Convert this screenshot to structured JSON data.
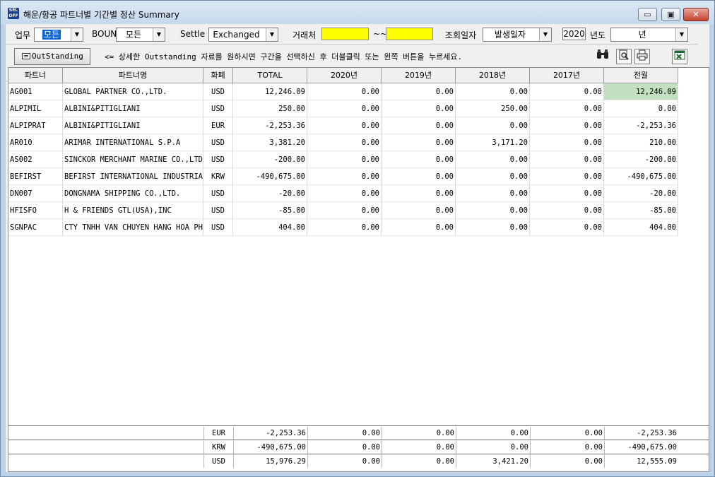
{
  "window": {
    "title": "해운/항공 파트너별 기간별 정산 Summary",
    "icon_text": "SEL OFF",
    "min_glyph": "▭",
    "max_glyph": "▣",
    "close_glyph": "✕"
  },
  "filters": {
    "business_label": "업무",
    "business_value": "모든",
    "bound_label": "BOUND",
    "bound_value": "모든",
    "settle_label": "Settle",
    "settle_value": "Exchanged",
    "partner_label": "거래처",
    "range_sep": "~~",
    "date_type_label": "조회일자",
    "date_type_value": "발생일자",
    "year_value": "2020",
    "year_label": "년도",
    "period_value": "년",
    "arrow": "▼"
  },
  "toolbar": {
    "outstanding_label": "OutStanding",
    "hint": "<= 상세한 Outstanding 자료를 원하시면 구간을 선택하신 후 더블클릭 또는 왼쪽 버튼을 누르세요.",
    "icons": [
      "binoculars-icon",
      "preview-icon",
      "print-icon",
      "excel-icon"
    ]
  },
  "columns": [
    "파트너",
    "파트너명",
    "화폐",
    "TOTAL",
    "2020년",
    "2019년",
    "2018년",
    "2017년",
    "전월"
  ],
  "rows": [
    {
      "code": "AG001",
      "name": "GLOBAL PARTNER CO.,LTD.",
      "cur": "USD",
      "total": "12,246.09",
      "y2020": "0.00",
      "y2019": "0.00",
      "y2018": "0.00",
      "y2017": "0.00",
      "prev": "12,246.09"
    },
    {
      "code": "ALPIMIL",
      "name": "ALBINI&PITIGLIANI",
      "cur": "USD",
      "total": "250.00",
      "y2020": "0.00",
      "y2019": "0.00",
      "y2018": "250.00",
      "y2017": "0.00",
      "prev": "0.00"
    },
    {
      "code": "ALPIPRAT",
      "name": "ALBINI&PITIGLIANI",
      "cur": "EUR",
      "total": "-2,253.36",
      "y2020": "0.00",
      "y2019": "0.00",
      "y2018": "0.00",
      "y2017": "0.00",
      "prev": "-2,253.36"
    },
    {
      "code": "AR010",
      "name": "ARIMAR INTERNATIONAL S.P.A",
      "cur": "USD",
      "total": "3,381.20",
      "y2020": "0.00",
      "y2019": "0.00",
      "y2018": "3,171.20",
      "y2017": "0.00",
      "prev": "210.00"
    },
    {
      "code": "AS002",
      "name": "SINCKOR MERCHANT MARINE CO.,LTD",
      "cur": "USD",
      "total": "-200.00",
      "y2020": "0.00",
      "y2019": "0.00",
      "y2018": "0.00",
      "y2017": "0.00",
      "prev": "-200.00"
    },
    {
      "code": "BEFIRST",
      "name": "BEFIRST INTERNATIONAL INDUSTRIAL",
      "cur": "KRW",
      "total": "-490,675.00",
      "y2020": "0.00",
      "y2019": "0.00",
      "y2018": "0.00",
      "y2017": "0.00",
      "prev": "-490,675.00"
    },
    {
      "code": "DN007",
      "name": "DONGNAMA SHIPPING CO.,LTD.",
      "cur": "USD",
      "total": "-20.00",
      "y2020": "0.00",
      "y2019": "0.00",
      "y2018": "0.00",
      "y2017": "0.00",
      "prev": "-20.00"
    },
    {
      "code": "HFISFO",
      "name": "H & FRIENDS GTL(USA),INC",
      "cur": "USD",
      "total": "-85.00",
      "y2020": "0.00",
      "y2019": "0.00",
      "y2018": "0.00",
      "y2017": "0.00",
      "prev": "-85.00"
    },
    {
      "code": "SGNPAC",
      "name": "CTY TNHH VAN CHUYEN HANG HOA PHON",
      "cur": "USD",
      "total": "404.00",
      "y2020": "0.00",
      "y2019": "0.00",
      "y2018": "0.00",
      "y2017": "0.00",
      "prev": "404.00"
    }
  ],
  "summary": [
    {
      "cur": "EUR",
      "total": "-2,253.36",
      "y2020": "0.00",
      "y2019": "0.00",
      "y2018": "0.00",
      "y2017": "0.00",
      "prev": "-2,253.36"
    },
    {
      "cur": "KRW",
      "total": "-490,675.00",
      "y2020": "0.00",
      "y2019": "0.00",
      "y2018": "0.00",
      "y2017": "0.00",
      "prev": "-490,675.00"
    },
    {
      "cur": "USD",
      "total": "15,976.29",
      "y2020": "0.00",
      "y2019": "0.00",
      "y2018": "3,421.20",
      "y2017": "0.00",
      "prev": "12,555.09"
    }
  ],
  "colors": {
    "highlight": "#c2dfc2",
    "partner_field": "#ffff00",
    "selection": "#0a64d8"
  }
}
